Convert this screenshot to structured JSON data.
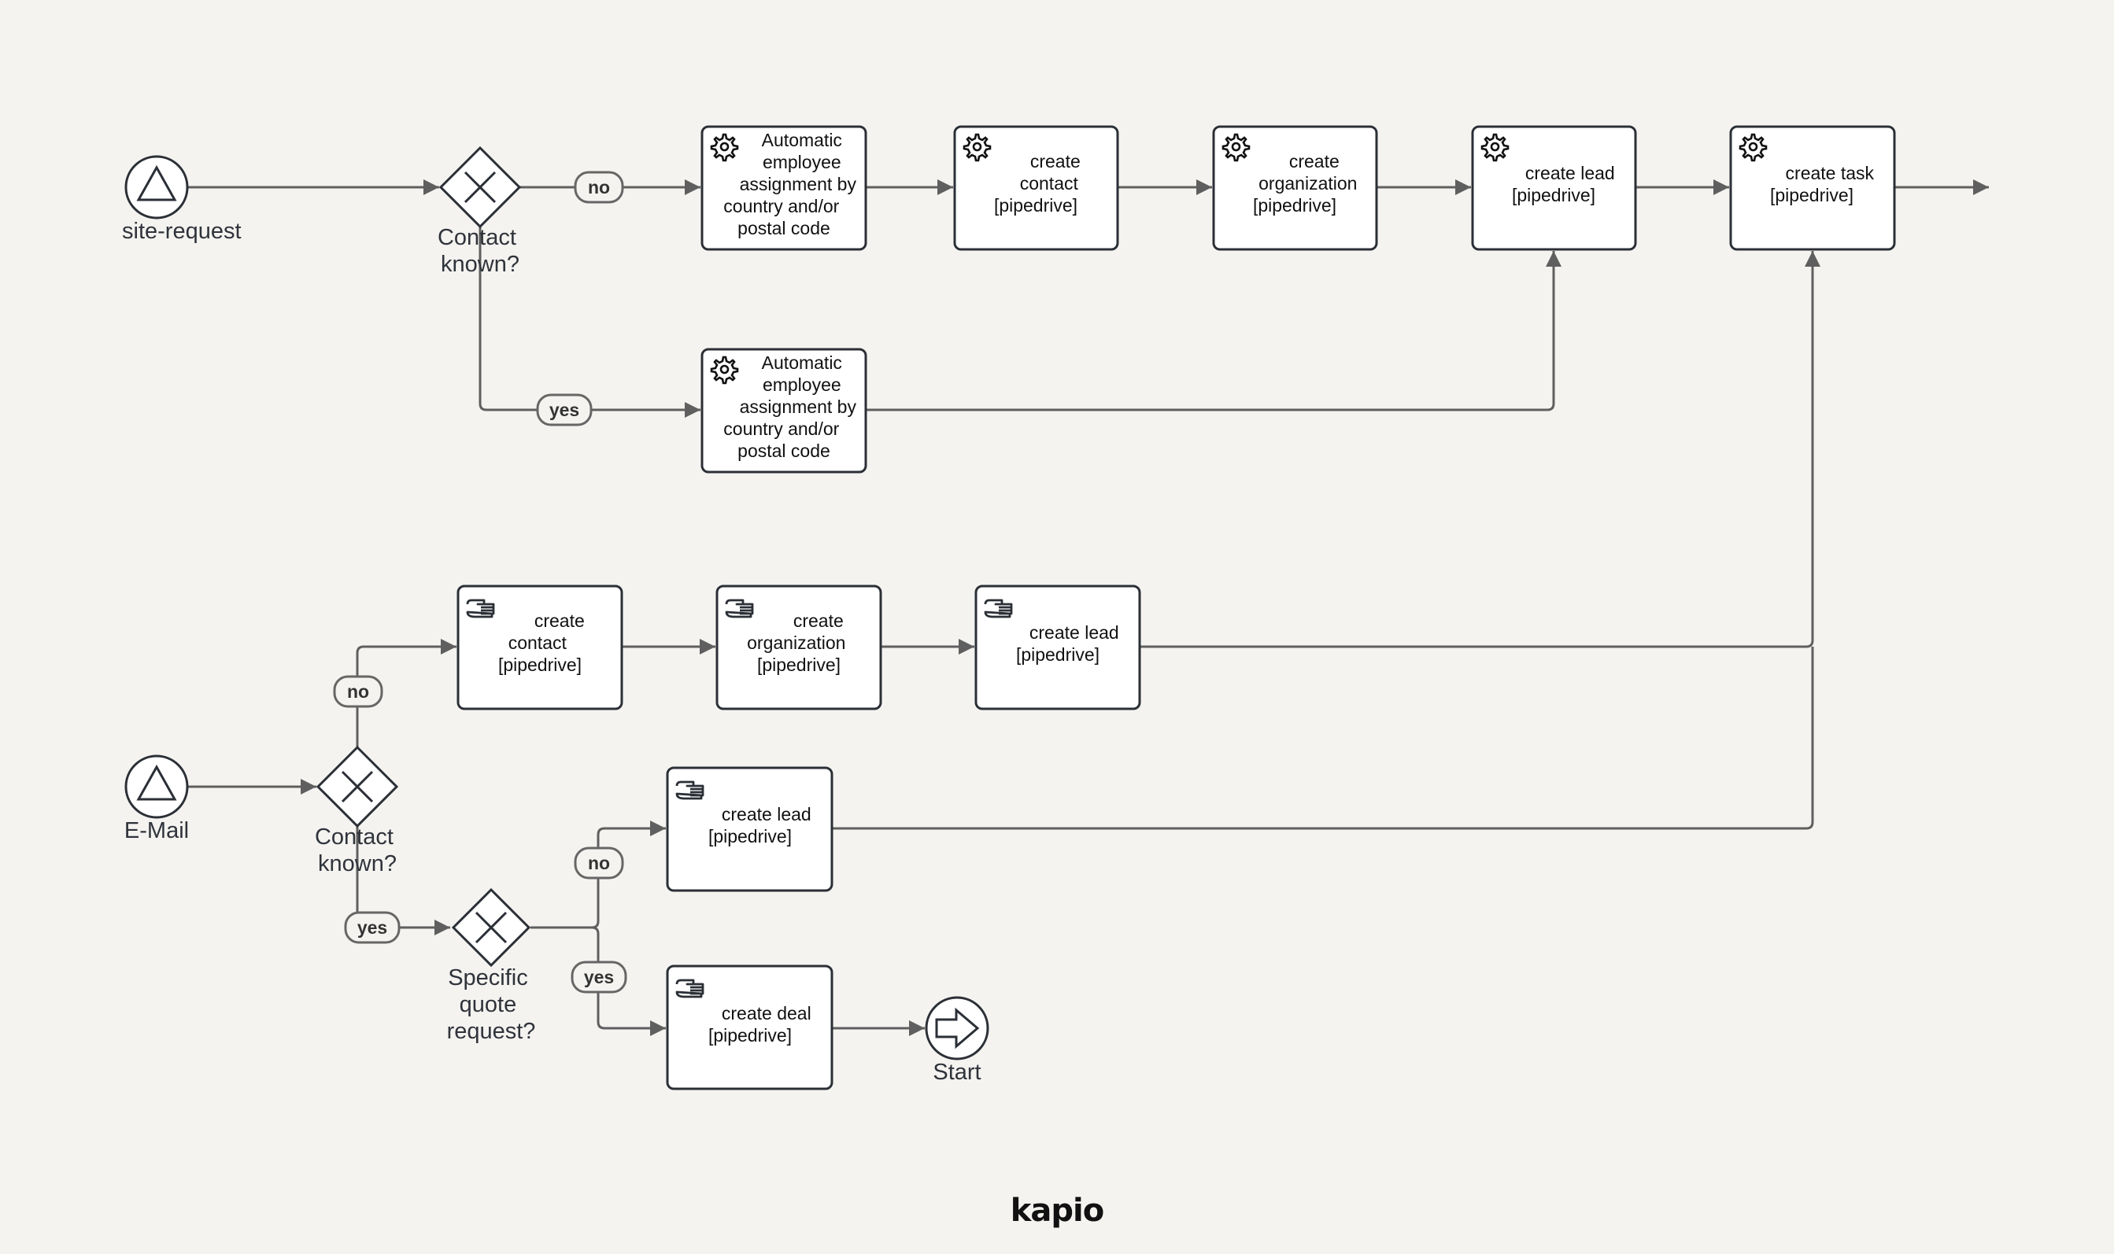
{
  "diagram": {
    "type": "BPMN process",
    "brand": "kapio",
    "colors": {
      "background": "#f4f3f0",
      "stroke": "#2b2f36",
      "flow": "#5f5f5f",
      "task_fill": "#ffffff"
    },
    "lane_top": {
      "start_event": {
        "label": "site-request",
        "icon": "triangle-signal-icon"
      },
      "gateway": {
        "label_lines": [
          "Contact",
          "known?"
        ],
        "icon": "exclusive-x-icon"
      },
      "flow_labels": {
        "no": "no",
        "yes": "yes"
      },
      "tasks": [
        {
          "id": "t1",
          "kind": "service",
          "icon": "gear-icon",
          "lines": [
            "Automatic",
            "employee",
            "assignment by",
            "country and/or",
            "postal code"
          ]
        },
        {
          "id": "t2",
          "kind": "service",
          "icon": "gear-icon",
          "lines": [
            "create",
            "contact",
            "[pipedrive]"
          ]
        },
        {
          "id": "t3",
          "kind": "service",
          "icon": "gear-icon",
          "lines": [
            "create",
            "organization",
            "[pipedrive]"
          ]
        },
        {
          "id": "t4",
          "kind": "service",
          "icon": "gear-icon",
          "lines": [
            "create lead",
            "[pipedrive]"
          ]
        },
        {
          "id": "t5",
          "kind": "service",
          "icon": "gear-icon",
          "lines": [
            "create task",
            "[pipedrive]"
          ]
        },
        {
          "id": "t6",
          "kind": "service",
          "icon": "gear-icon",
          "lines": [
            "Automatic",
            "employee",
            "assignment by",
            "country and/or",
            "postal code"
          ]
        }
      ]
    },
    "lane_bottom": {
      "start_event": {
        "label": "E-Mail",
        "icon": "triangle-signal-icon"
      },
      "gateway_contact": {
        "label_lines": [
          "Contact",
          "known?"
        ],
        "icon": "exclusive-x-icon"
      },
      "gateway_quote": {
        "label_lines": [
          "Specific",
          "quote",
          "request?"
        ],
        "icon": "exclusive-x-icon"
      },
      "flow_labels": {
        "no_contact": "no",
        "yes_contact": "yes",
        "no_quote": "no",
        "yes_quote": "yes"
      },
      "tasks": [
        {
          "id": "m1",
          "kind": "manual",
          "icon": "hand-icon",
          "lines": [
            "create",
            "contact",
            "[pipedrive]"
          ]
        },
        {
          "id": "m2",
          "kind": "manual",
          "icon": "hand-icon",
          "lines": [
            "create",
            "organization",
            "[pipedrive]"
          ]
        },
        {
          "id": "m3",
          "kind": "manual",
          "icon": "hand-icon",
          "lines": [
            "create lead",
            "[pipedrive]"
          ]
        },
        {
          "id": "m4",
          "kind": "manual",
          "icon": "hand-icon",
          "lines": [
            "create lead",
            "[pipedrive]"
          ]
        },
        {
          "id": "m5",
          "kind": "manual",
          "icon": "hand-icon",
          "lines": [
            "create deal",
            "[pipedrive]"
          ]
        }
      ],
      "end_event": {
        "label": "Start",
        "icon": "arrow-link-icon"
      }
    }
  }
}
